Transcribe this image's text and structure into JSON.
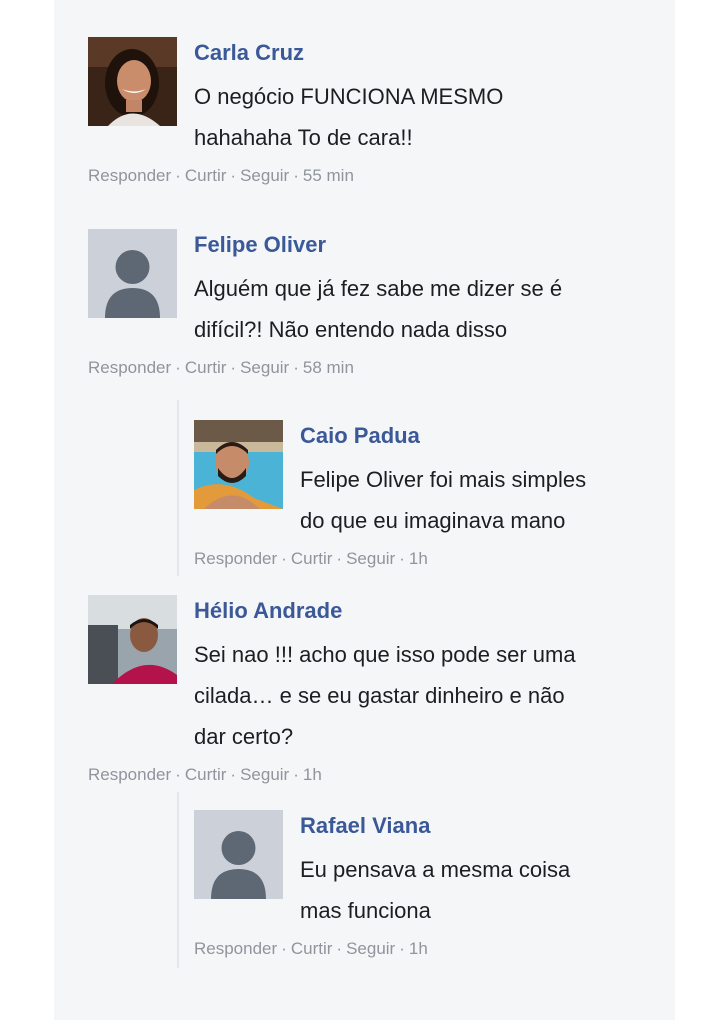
{
  "colors": {
    "name": "#3b5998",
    "text": "#1c1e21",
    "meta": "#90949c",
    "background": "#f5f6f8"
  },
  "comments": [
    {
      "author": "Carla Cruz",
      "avatar": "profile-photo-woman",
      "lines": [
        "O negócio FUNCIONA MESMO",
        "hahahaha To de cara!!"
      ],
      "actions": {
        "reply": "Responder",
        "like": "Curtir",
        "follow": "Seguir",
        "time": "55 min"
      }
    },
    {
      "author": "Felipe Oliver",
      "avatar": "default-user-icon",
      "lines": [
        "Alguém que já fez sabe me dizer se é",
        "difícil?! Não entendo nada disso"
      ],
      "actions": {
        "reply": "Responder",
        "like": "Curtir",
        "follow": "Seguir",
        "time": "58 min"
      }
    },
    {
      "author": "Caio Padua",
      "avatar": "profile-photo-man-pool",
      "lines": [
        "Felipe Oliver foi mais simples",
        "do que eu imaginava mano"
      ],
      "actions": {
        "reply": "Responder",
        "like": "Curtir",
        "follow": "Seguir",
        "time": "1h"
      }
    },
    {
      "author": "Hélio Andrade",
      "avatar": "profile-photo-man-car",
      "lines": [
        "Sei nao !!! acho que isso pode ser uma",
        "cilada… e se eu gastar dinheiro e não",
        "dar certo?"
      ],
      "actions": {
        "reply": "Responder",
        "like": "Curtir",
        "follow": "Seguir",
        "time": "1h"
      }
    },
    {
      "author": "Rafael Viana",
      "avatar": "default-user-icon",
      "lines": [
        "Eu pensava a mesma coisa",
        "mas funciona"
      ],
      "actions": {
        "reply": "Responder",
        "like": "Curtir",
        "follow": "Seguir",
        "time": "1h"
      }
    }
  ]
}
